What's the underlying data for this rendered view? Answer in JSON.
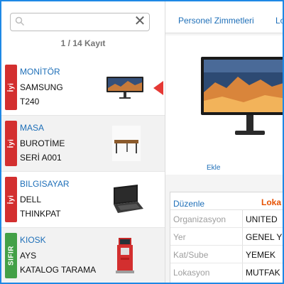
{
  "search": {
    "placeholder": ""
  },
  "list": {
    "count_text": "1 / 14 Kayıt",
    "items": [
      {
        "condition": "İyi",
        "category": "MONİTÖR",
        "line1": "SAMSUNG",
        "line2": "T240",
        "thumb": "monitor-icon"
      },
      {
        "condition": "İyi",
        "category": "MASA",
        "line1": "BUROTİME",
        "line2": "SERİ A001",
        "thumb": "desk-icon"
      },
      {
        "condition": "İyi",
        "category": "BILGISAYAR",
        "line1": "DELL",
        "line2": "THINKPAT",
        "thumb": "laptop-icon"
      },
      {
        "condition": "SIFIR",
        "category": "KIOSK",
        "line1": "AYS",
        "line2": "KATALOG TARAMA",
        "thumb": "kiosk-icon"
      }
    ]
  },
  "detail": {
    "tabs": [
      "Personel Zimmetleri",
      "Lo"
    ],
    "add_label": "Ekle",
    "edit_label": "Düzenle",
    "location_header": "Loka",
    "fields": [
      {
        "label": "Organizasyon",
        "value": "UNITED"
      },
      {
        "label": "Yer",
        "value": "GENEL Y"
      },
      {
        "label": "Kat/Sube",
        "value": "YEMEK"
      },
      {
        "label": "Lokasyon",
        "value": "MUTFAK"
      }
    ]
  },
  "colors": {
    "accent": "#1e88e5",
    "link": "#1e6fb8",
    "badge_iyi": "#d32f2f",
    "badge_sifir": "#43a047",
    "selected_marker": "#e53935",
    "location_header": "#e65100"
  }
}
